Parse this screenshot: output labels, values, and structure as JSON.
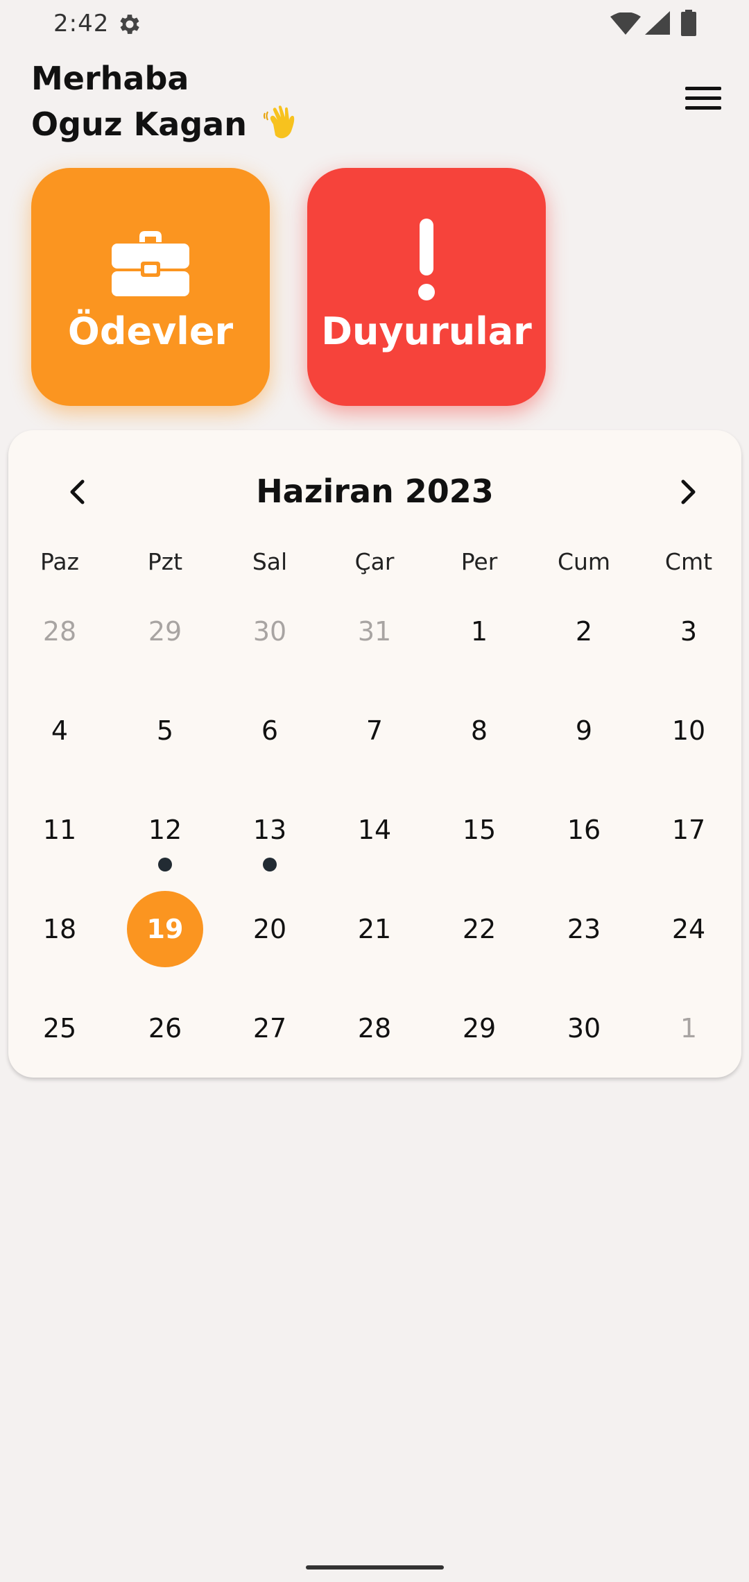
{
  "status_bar": {
    "time": "2:42",
    "icons": [
      "gear-icon",
      "wifi-icon",
      "cellular-icon",
      "battery-icon"
    ]
  },
  "header": {
    "greeting_line1": "Merhaba",
    "greeting_line2": "Oguz Kagan",
    "greeting_emoji": "waving-hand-icon",
    "menu_icon": "hamburger-menu-icon"
  },
  "tiles": [
    {
      "label": "Ödevler",
      "icon": "briefcase-icon",
      "color": "#fb9520"
    },
    {
      "label": "Duyurular",
      "icon": "exclamation-icon",
      "color": "#f6433b"
    }
  ],
  "calendar": {
    "title": "Haziran 2023",
    "weekdays": [
      "Paz",
      "Pzt",
      "Sal",
      "Çar",
      "Per",
      "Cum",
      "Cmt"
    ],
    "selected_day": "19",
    "selected_color": "#fb9520",
    "weeks": [
      [
        "28",
        "29",
        "30",
        "31",
        "1",
        "2",
        "3"
      ],
      [
        "4",
        "5",
        "6",
        "7",
        "8",
        "9",
        "10"
      ],
      [
        "11",
        "12",
        "13",
        "14",
        "15",
        "16",
        "17"
      ],
      [
        "18",
        "19",
        "20",
        "21",
        "22",
        "23",
        "24"
      ],
      [
        "25",
        "26",
        "27",
        "28",
        "29",
        "30",
        "1"
      ]
    ],
    "muted_cells": [
      [
        0,
        0
      ],
      [
        0,
        1
      ],
      [
        0,
        2
      ],
      [
        0,
        3
      ],
      [
        4,
        6
      ]
    ],
    "event_cells": [
      [
        2,
        1
      ],
      [
        2,
        2
      ]
    ],
    "selected_cell": [
      3,
      1
    ]
  }
}
